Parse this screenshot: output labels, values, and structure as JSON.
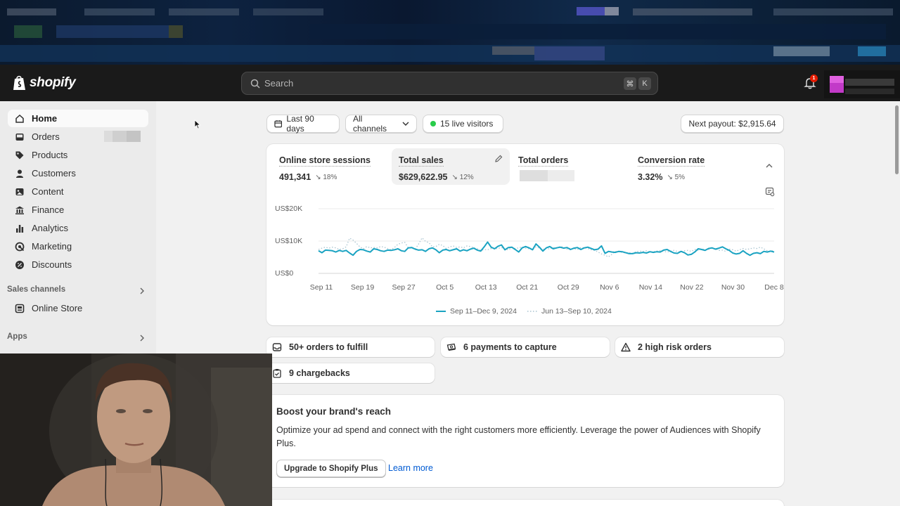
{
  "app": {
    "name": "shopify"
  },
  "search": {
    "placeholder": "Search",
    "shortcut_1": "⌘",
    "shortcut_2": "K"
  },
  "notifications": {
    "count": "1"
  },
  "sidebar": {
    "items": [
      {
        "label": "Home",
        "icon": "home-icon"
      },
      {
        "label": "Orders",
        "icon": "inbox-icon"
      },
      {
        "label": "Products",
        "icon": "tag-icon"
      },
      {
        "label": "Customers",
        "icon": "person-icon"
      },
      {
        "label": "Content",
        "icon": "content-icon"
      },
      {
        "label": "Finance",
        "icon": "bank-icon"
      },
      {
        "label": "Analytics",
        "icon": "bar-chart-icon"
      },
      {
        "label": "Marketing",
        "icon": "target-icon"
      },
      {
        "label": "Discounts",
        "icon": "discount-icon"
      }
    ],
    "sales_channels_title": "Sales channels",
    "online_store_label": "Online Store",
    "apps_title": "Apps"
  },
  "filters": {
    "date_range": "Last 90 days",
    "channels": "All channels",
    "live_visitors": "15 live visitors",
    "payout": "Next payout: $2,915.64"
  },
  "metrics": [
    {
      "label": "Online store sessions",
      "value": "491,341",
      "change": "18%"
    },
    {
      "label": "Total sales",
      "value": "$629,622.95",
      "change": "12%"
    },
    {
      "label": "Total orders",
      "value": "",
      "change": ""
    },
    {
      "label": "Conversion rate",
      "value": "3.32%",
      "change": "5%"
    }
  ],
  "chart_data": {
    "type": "line",
    "y_ticks": [
      "US$20K",
      "US$10K",
      "US$0"
    ],
    "ylim": [
      0,
      20000
    ],
    "x_ticks": [
      "Sep 11",
      "Sep 19",
      "Sep 27",
      "Oct 5",
      "Oct 13",
      "Oct 21",
      "Oct 29",
      "Nov 6",
      "Nov 14",
      "Nov 22",
      "Nov 30",
      "Dec 8"
    ],
    "series": [
      {
        "name": "Sep 11–Dec 9, 2024",
        "color": "#1aa3c2",
        "style": "solid",
        "values": [
          7000,
          6400,
          7200,
          7100,
          7000,
          6600,
          7100,
          6800,
          7100,
          6300,
          5600,
          6800,
          7400,
          7300,
          6900,
          6600,
          7600,
          7400,
          7000,
          6800,
          7200,
          7100,
          7300,
          7600,
          7000,
          6800,
          7900,
          8000,
          7500,
          7200,
          7300,
          6800,
          7600,
          7900,
          7300,
          6400,
          7200,
          7400,
          7000,
          7300,
          7600,
          6900,
          7300,
          7000,
          7500,
          7800,
          7200,
          6900,
          8200,
          9700,
          8100,
          7600,
          8400,
          8800,
          7300,
          8000,
          8100,
          7400,
          6600,
          7900,
          8300,
          7900,
          7300,
          9100,
          8100,
          6900,
          7900,
          8300,
          7600,
          7900,
          8100,
          7800,
          8000,
          7400,
          7800,
          8000,
          7400,
          7900,
          8100,
          7700,
          7300,
          7500,
          8500,
          6200,
          6800,
          6600,
          6500,
          6800,
          6700,
          6400,
          6100,
          6100,
          6400,
          6300,
          6500,
          6300,
          6700,
          6500,
          6700,
          6600,
          7200,
          7400,
          6800,
          6300,
          6200,
          6800,
          6400,
          5700,
          5900,
          6600,
          7600,
          7400,
          7100,
          7700,
          7900,
          7500,
          7800,
          8200,
          7600,
          7100,
          6300,
          6000,
          6200,
          7000,
          6200,
          5600,
          6200,
          6400,
          6100,
          6800,
          6600,
          6900,
          6600
        ]
      },
      {
        "name": "Jun 13–Sep 10, 2024",
        "color": "#a9c4d0",
        "style": "dotted",
        "values": [
          7400,
          7800,
          8100,
          7800,
          8100,
          7900,
          7400,
          7600,
          8200,
          10900,
          10300,
          9300,
          8200,
          7600,
          8300,
          7900,
          8000,
          7900,
          8300,
          8100,
          7700,
          7300,
          8000,
          9000,
          9400,
          9600,
          7900,
          7800,
          7500,
          9100,
          11000,
          9900,
          9500,
          8200,
          8300,
          9000,
          8600,
          7700,
          8200,
          8500,
          8000,
          8200,
          7900,
          8500,
          8300,
          7900,
          7600,
          7100,
          7400,
          7300,
          7700,
          7600,
          7700,
          8000,
          7500,
          7300,
          8000,
          7700,
          7900,
          8200,
          7800,
          7600,
          7300,
          8200,
          7800,
          7400,
          7900,
          7500,
          8000,
          7800,
          8300,
          8100,
          7500,
          7800,
          7600,
          7400,
          8000,
          7900,
          7700,
          7300,
          7100,
          6600,
          6000,
          5600,
          5100,
          5900,
          6800,
          6700,
          6500,
          6300,
          6400,
          6200,
          6700,
          6900,
          6800,
          7000,
          6600,
          6700,
          6900,
          7000,
          6800,
          6600,
          6900,
          7100,
          6800,
          6700,
          7000,
          7100,
          6800,
          7400,
          7200,
          7600,
          7300,
          7400,
          7800,
          7600,
          7100,
          7200,
          6800,
          7500,
          7300,
          6900,
          7300,
          7700,
          7400,
          7600,
          7900,
          7700,
          8100,
          7600,
          7000,
          6800,
          7200
        ]
      }
    ]
  },
  "tasks": {
    "fulfill": "50+ orders to fulfill",
    "payments": "6 payments to capture",
    "risk": "2 high risk orders",
    "chargebacks": "9 chargebacks"
  },
  "promo": {
    "title": "Boost your brand's reach",
    "body": "Optimize your ad spend and connect with the right customers more efficiently. Leverage the power of Audiences with Shopify Plus.",
    "primary_button": "Upgrade to Shopify Plus",
    "link": "Learn more"
  }
}
